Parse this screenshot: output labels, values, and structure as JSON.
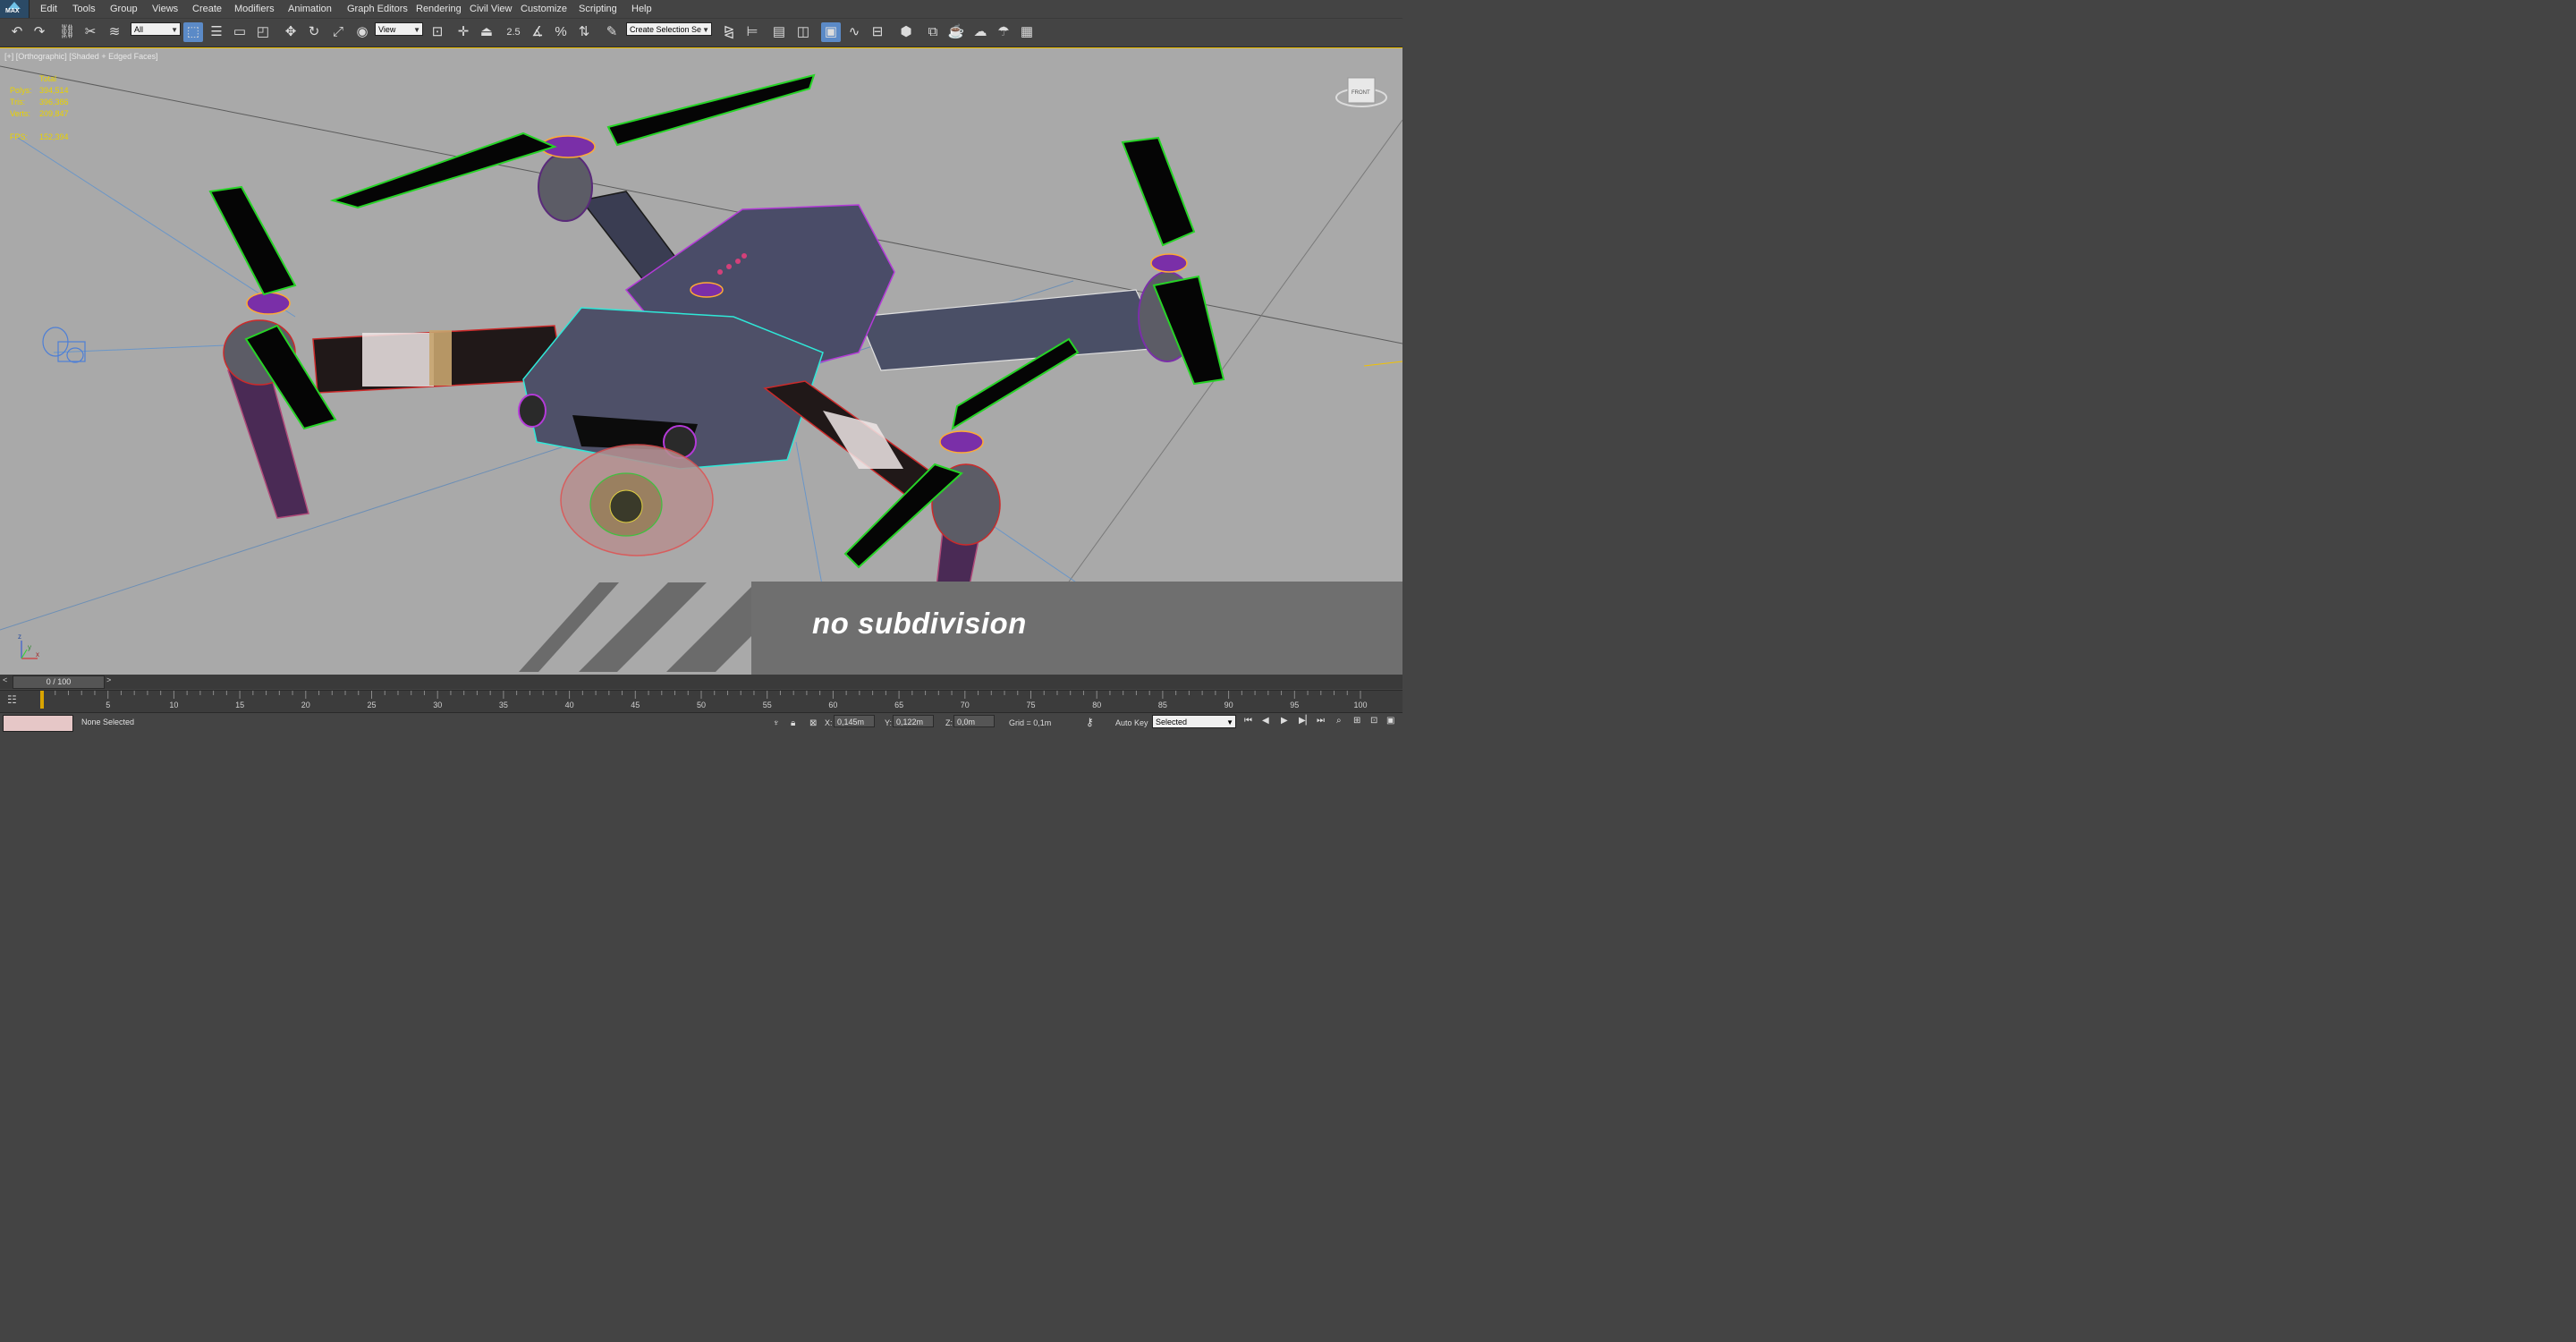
{
  "app": {
    "logo_text": "MAX"
  },
  "menu": [
    "Edit",
    "Tools",
    "Group",
    "Views",
    "Create",
    "Modifiers",
    "Animation",
    "Graph Editors",
    "Rendering",
    "Civil View",
    "Customize",
    "Scripting",
    "Help"
  ],
  "toolbar": {
    "filter_value": "All",
    "ref_coord_value": "View",
    "snap_value": "2.5",
    "selection_set_value": "Create Selection Se"
  },
  "viewport": {
    "label": "[+] [Orthographic] [Shaded + Edged Faces]",
    "stats": {
      "header": "Total",
      "rows": [
        {
          "k": "Polys:",
          "v": "394,514"
        },
        {
          "k": "Tris:",
          "v": "396,386"
        },
        {
          "k": "Verts:",
          "v": "209,847"
        },
        {
          "k": "FPS:",
          "v": "152,394"
        }
      ]
    },
    "viewcube_label": "FRONT",
    "axis_labels": {
      "x": "x",
      "y": "y",
      "z": "z"
    },
    "caption": "no subdivision"
  },
  "timeline": {
    "slider_label": "0 / 100",
    "prev_arrow": "<",
    "next_arrow": ">",
    "ticks": [
      "5",
      "10",
      "15",
      "20",
      "25",
      "30",
      "35",
      "40",
      "45",
      "50",
      "55",
      "60",
      "65",
      "70",
      "75",
      "80",
      "85",
      "90",
      "95",
      "100"
    ]
  },
  "status": {
    "selection_text": "None Selected",
    "x_label": "X:",
    "x_value": "0,145m",
    "y_label": "Y:",
    "y_value": "0,122m",
    "z_label": "Z:",
    "z_value": "0,0m",
    "grid": "Grid = 0,1m",
    "auto_key": "Auto Key",
    "key_mode": "Selected"
  },
  "colors": {
    "viewport_bg": "#a9a9a9",
    "ui_bg": "#444444",
    "stats_text": "#e9d200",
    "active_button": "#5b8ac7",
    "caption_band": "#6f6f6f"
  }
}
